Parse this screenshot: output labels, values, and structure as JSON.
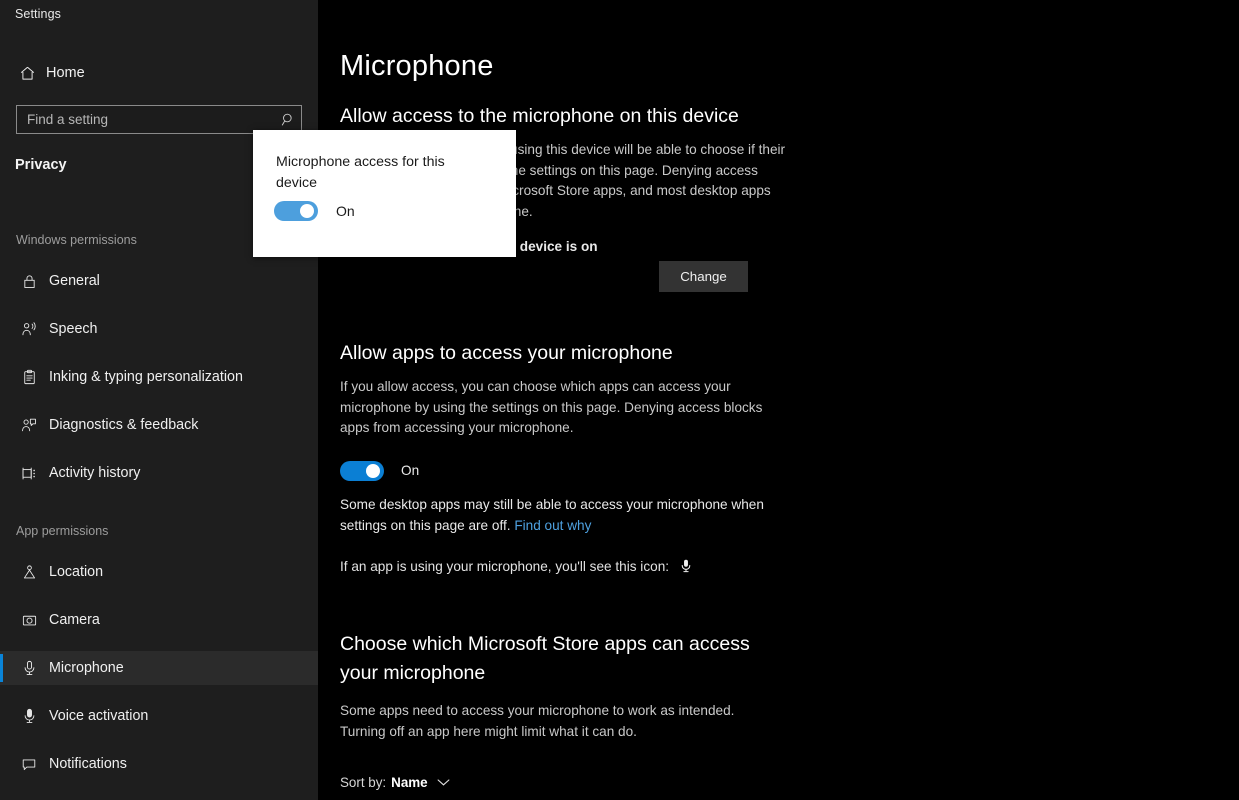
{
  "app": {
    "title": "Settings"
  },
  "sidebar": {
    "home_label": "Home",
    "home_icon": "home-icon",
    "search": {
      "placeholder": "Find a setting",
      "value": "",
      "icon": "search-icon"
    },
    "section_label": "Privacy",
    "groups": [
      {
        "heading": "Windows permissions",
        "items": [
          {
            "label": "General",
            "icon": "lock-icon",
            "selected": false
          },
          {
            "label": "Speech",
            "icon": "speech-person-icon",
            "selected": false
          },
          {
            "label": "Inking & typing personalization",
            "icon": "clipboard-pen-icon",
            "selected": false
          },
          {
            "label": "Diagnostics & feedback",
            "icon": "feedback-person-icon",
            "selected": false
          },
          {
            "label": "Activity history",
            "icon": "activity-history-icon",
            "selected": false
          }
        ]
      },
      {
        "heading": "App permissions",
        "items": [
          {
            "label": "Location",
            "icon": "location-pin-icon",
            "selected": false
          },
          {
            "label": "Camera",
            "icon": "camera-icon",
            "selected": false
          },
          {
            "label": "Microphone",
            "icon": "microphone-icon",
            "selected": true
          },
          {
            "label": "Voice activation",
            "icon": "voice-activation-icon",
            "selected": false
          },
          {
            "label": "Notifications",
            "icon": "notification-icon",
            "selected": false
          }
        ]
      }
    ]
  },
  "main": {
    "page_title": "Microphone",
    "device_section": {
      "heading": "Allow access to the microphone on this device",
      "description": "If you allow access, anyone using this device will be able to choose if their apps have access by using the settings on this page. Denying access blocks Windows features, Microsoft Store apps, and most desktop apps from accessing the microphone.",
      "status": "Microphone access for this device is on",
      "change_button": "Change"
    },
    "apps_section": {
      "heading": "Allow apps to access your microphone",
      "description": "If you allow access, you can choose which apps can access your microphone by using the settings on this page. Denying access blocks apps from accessing your microphone.",
      "toggle_state": "On",
      "note_text": "Some desktop apps may still be able to access your microphone when settings on this page are off.",
      "note_link": "Find out why",
      "icon_note": "If an app is using your microphone, you'll see this icon:",
      "icon_note_icon": "microphone-icon"
    },
    "store_section": {
      "heading": "Choose which Microsoft Store apps can access your microphone",
      "description": "Some apps need to access your microphone to work as intended. Turning off an app here might limit what it can do.",
      "sort_label": "Sort by:",
      "sort_value": "Name",
      "sort_icon": "chevron-down-icon"
    }
  },
  "flyout": {
    "title": "Microphone access for this device",
    "toggle_state": "On"
  },
  "colors": {
    "accent": "#0a84d8",
    "toggle_on": "#0b7fd4",
    "flyout_toggle": "#4d9fdd",
    "link": "#4ea1e0",
    "sidebar_bg": "#1e1e1e",
    "main_bg": "#000000",
    "button_bg": "#333333"
  }
}
